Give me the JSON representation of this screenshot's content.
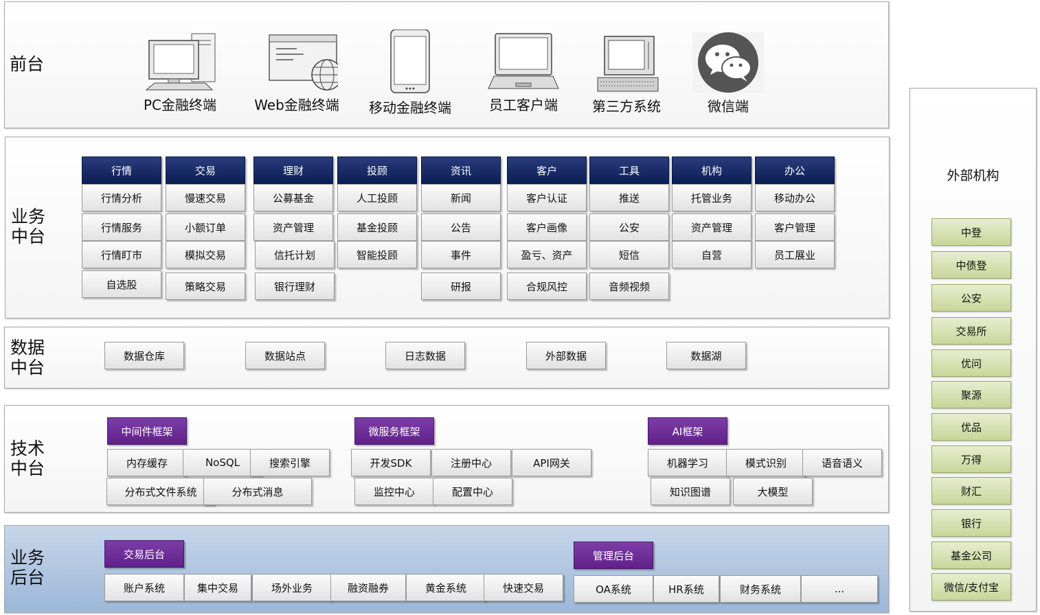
{
  "front": {
    "title": "前台",
    "terminals": [
      {
        "label": "PC金融终端",
        "icon": "pc-icon"
      },
      {
        "label": "Web金融终端",
        "icon": "web-icon"
      },
      {
        "label": "移动金融终端",
        "icon": "mobile-icon"
      },
      {
        "label": "员工客户端",
        "icon": "laptop-icon"
      },
      {
        "label": "第三方系统",
        "icon": "terminal-icon"
      },
      {
        "label": "微信端",
        "icon": "wechat-icon"
      }
    ]
  },
  "business_mid": {
    "title": "业务\n中台",
    "columns": [
      {
        "header": "行情",
        "items": [
          "行情分析",
          "行情服务",
          "行情盯市",
          "自选股"
        ]
      },
      {
        "header": "交易",
        "items": [
          "慢速交易",
          "小额订单",
          "模拟交易",
          "策略交易"
        ]
      },
      {
        "header": "理财",
        "items": [
          "公募基金",
          "资产管理",
          "信托计划",
          "银行理财"
        ]
      },
      {
        "header": "投顾",
        "items": [
          "人工投顾",
          "基金投顾",
          "智能投顾"
        ]
      },
      {
        "header": "资讯",
        "items": [
          "新闻",
          "公告",
          "事件",
          "研报"
        ]
      },
      {
        "header": "客户",
        "items": [
          "客户认证",
          "客户画像",
          "盈亏、资产",
          "合规风控"
        ]
      },
      {
        "header": "工具",
        "items": [
          "推送",
          "公安",
          "短信",
          "音频视频"
        ]
      },
      {
        "header": "机构",
        "items": [
          "托管业务",
          "资产管理",
          "自营"
        ]
      },
      {
        "header": "办公",
        "items": [
          "移动办公",
          "客户管理",
          "员工展业"
        ]
      }
    ]
  },
  "data_mid": {
    "title": "数据\n中台",
    "items": [
      "数据仓库",
      "数据站点",
      "日志数据",
      "外部数据",
      "数据湖"
    ]
  },
  "tech_mid": {
    "title": "技术\n中台",
    "groups": [
      {
        "header": "中间件框架",
        "row1": [
          "内存缓存",
          "NoSQL",
          "搜索引擎"
        ],
        "row2": [
          "分布式文件系统",
          "分布式消息"
        ]
      },
      {
        "header": "微服务框架",
        "row1": [
          "开发SDK",
          "注册中心",
          "API网关"
        ],
        "row2": [
          "监控中心",
          "配置中心"
        ]
      },
      {
        "header": "AI框架",
        "row1": [
          "机器学习",
          "模式识别",
          "语音语义"
        ],
        "row2": [
          "知识图谱",
          "大模型"
        ]
      }
    ]
  },
  "back": {
    "title": "业务\n后台",
    "groups": [
      {
        "header": "交易后台",
        "items": [
          "账户系统",
          "集中交易",
          "场外业务",
          "融资融券",
          "黄金系统",
          "快速交易"
        ]
      },
      {
        "header": "管理后台",
        "items": [
          "OA系统",
          "HR系统",
          "财务系统",
          "..."
        ]
      }
    ]
  },
  "external": {
    "title": "外部机构",
    "items": [
      "中登",
      "中债登",
      "公安",
      "交易所",
      "优问",
      "聚源",
      "优品",
      "万得",
      "财汇",
      "银行",
      "基金公司",
      "微信/支付宝"
    ]
  },
  "colors": {
    "header_navy": "#0c1e55",
    "framework_purple": "#60208a",
    "external_green": "#c9d69a",
    "backend_blue": "#9cb7d8"
  }
}
